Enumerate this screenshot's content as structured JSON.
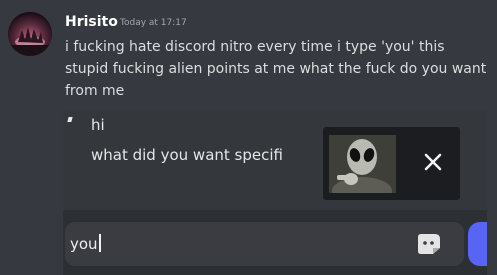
{
  "message": {
    "username": "Hrisito",
    "timestamp": "Today at 17:17",
    "text": "i fucking hate discord nitro every time i type 'you' this stupid fucking alien points at me what the fuck do you want from me"
  },
  "embedded_screenshot": {
    "line1": "hi",
    "line2": "what did you want specifi",
    "sticker_suggestion": {
      "icon": "alien-sticker",
      "close_icon": "close-icon"
    },
    "input_value": "you",
    "input_icon": "sticker-picker-icon"
  },
  "colors": {
    "background": "#36393f",
    "username": "#ffffff",
    "text": "#dcddde",
    "timestamp": "#a3a6aa",
    "accent": "#5865f2"
  }
}
